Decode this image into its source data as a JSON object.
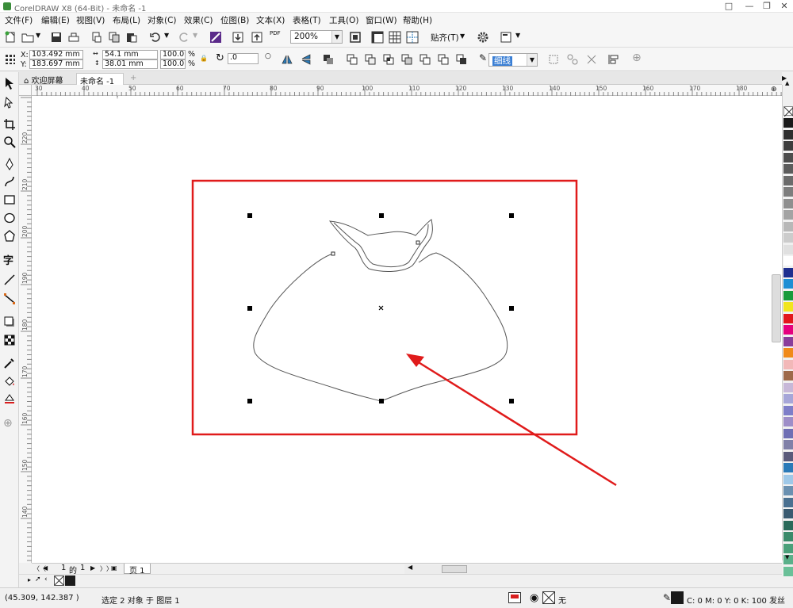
{
  "app": {
    "title": "CorelDRAW X8 (64-Bit) - 未命名 -1"
  },
  "menu": [
    "文件(F)",
    "编辑(E)",
    "视图(V)",
    "布局(L)",
    "对象(C)",
    "效果(C)",
    "位图(B)",
    "文本(X)",
    "表格(T)",
    "工具(O)",
    "窗口(W)",
    "帮助(H)"
  ],
  "toolbar": {
    "zoom_value": "200%",
    "snap_label": "贴齐(T)",
    "pdf_label": "PDF"
  },
  "propbar": {
    "x_label": "X:",
    "x_value": "103.492 mm",
    "y_label": "Y:",
    "y_value": "183.697 mm",
    "w_value": "54.1 mm",
    "h_value": "38.01 mm",
    "scale_w": "100.0",
    "scale_h": "100.0",
    "percent": "%",
    "angle_value": ".0",
    "outline_width": "细线"
  },
  "tabs": {
    "welcome": "欢迎屏幕",
    "doc": "未命名 -1"
  },
  "ruler": {
    "h": [
      "30",
      "40",
      "50",
      "60",
      "70",
      "80",
      "90",
      "100",
      "110",
      "120",
      "130",
      "140",
      "150",
      "160",
      "170",
      "180"
    ],
    "v": [
      "220",
      "210",
      "200",
      "190",
      "180",
      "170",
      "160",
      "150",
      "140"
    ]
  },
  "pagenav": {
    "current": "1",
    "of": "的",
    "total": "1",
    "page_tab": "页 1"
  },
  "status": {
    "coords": "(45.309, 142.387 )",
    "selection": "选定 2 对象 于 图层 1",
    "fill_none": "无",
    "color_info": "C: 0 M: 0 Y: 0 K: 100 发丝"
  },
  "colors": {
    "highlight_red": "#e01b1b",
    "palette": [
      "#1a1a1a",
      "#2e2e2e",
      "#3d3d3d",
      "#4d4d4d",
      "#5c5c5c",
      "#6b6b6b",
      "#7d7d7d",
      "#8f8f8f",
      "#a3a3a3",
      "#b8b8b8",
      "#cccccc",
      "#e0e0e0",
      "#ffffff",
      "#1f2f8f",
      "#1f8fd4",
      "#1a9b3c",
      "#f1e51f",
      "#e3161c",
      "#e5007e",
      "#8a3d9a",
      "#f08a1a",
      "#f2b8b8",
      "#9e6a4a",
      "#c7b8d8",
      "#a6a6d8",
      "#7e7ec8",
      "#9e8ec8",
      "#6f6fb4",
      "#8080a8",
      "#5a5a7a",
      "#2a7ab8",
      "#9ec8e8",
      "#6a90b0",
      "#4a7090",
      "#3a5a70",
      "#2a6a5a",
      "#3a8a6a",
      "#4aa07a",
      "#5ab08a",
      "#6ac098"
    ]
  }
}
